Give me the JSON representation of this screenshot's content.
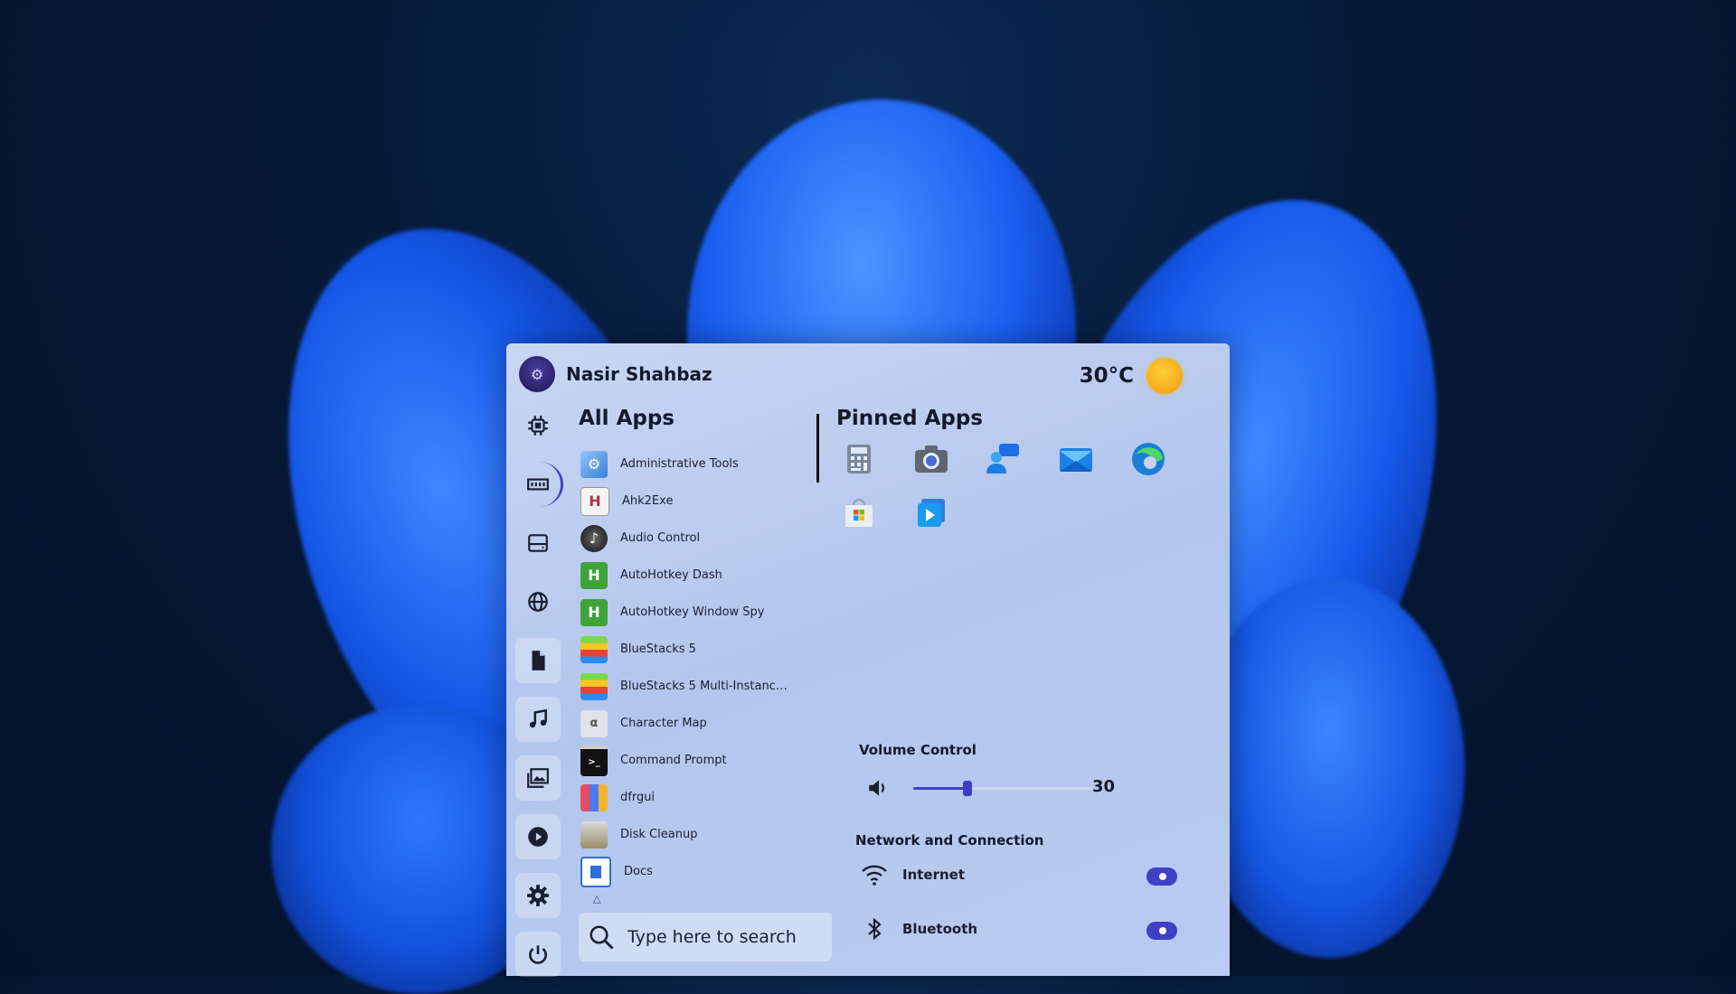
{
  "user": {
    "name": "Nasir Shahbaz"
  },
  "weather": {
    "temperature": "30°C",
    "icon": "sun-icon"
  },
  "sections": {
    "all_apps": "All Apps",
    "pinned_apps": "Pinned Apps"
  },
  "rail": [
    {
      "icon": "cpu-icon"
    },
    {
      "icon": "memory-icon"
    },
    {
      "icon": "drive-icon"
    },
    {
      "icon": "globe-icon"
    },
    {
      "icon": "document-icon"
    },
    {
      "icon": "music-icon"
    },
    {
      "icon": "pictures-icon"
    },
    {
      "icon": "video-play-icon"
    },
    {
      "icon": "settings-gear-icon"
    },
    {
      "icon": "power-icon"
    }
  ],
  "all_apps": [
    {
      "label": "Administrative Tools",
      "icon": "admin-tools-icon"
    },
    {
      "label": "Ahk2Exe",
      "icon": "ahk2exe-icon"
    },
    {
      "label": "Audio Control",
      "icon": "audio-control-icon"
    },
    {
      "label": "AutoHotkey Dash",
      "icon": "autohotkey-icon"
    },
    {
      "label": "AutoHotkey Window Spy",
      "icon": "autohotkey-icon"
    },
    {
      "label": "BlueStacks 5",
      "icon": "bluestacks-icon"
    },
    {
      "label": "BlueStacks 5 Multi-Instance...",
      "icon": "bluestacks-icon"
    },
    {
      "label": "Character Map",
      "icon": "character-map-icon"
    },
    {
      "label": "Command Prompt",
      "icon": "command-prompt-icon"
    },
    {
      "label": "dfrgui",
      "icon": "dfrgui-icon"
    },
    {
      "label": "Disk Cleanup",
      "icon": "disk-cleanup-icon"
    },
    {
      "label": "Docs",
      "icon": "docs-icon"
    }
  ],
  "pinned": [
    {
      "icon": "calculator-icon"
    },
    {
      "icon": "camera-icon"
    },
    {
      "icon": "feedback-chat-icon"
    },
    {
      "icon": "mail-icon"
    },
    {
      "icon": "edge-browser-icon"
    },
    {
      "icon": "store-icon"
    },
    {
      "icon": "media-player-icon"
    }
  ],
  "volume": {
    "title": "Volume Control",
    "value": "30",
    "level": 0.3
  },
  "network": {
    "title": "Network and Connection",
    "items": [
      {
        "label": "Internet",
        "icon": "wifi-icon",
        "enabled": true
      },
      {
        "label": "Bluetooth",
        "icon": "bluetooth-icon",
        "enabled": true
      }
    ]
  },
  "search": {
    "placeholder": "Type here to search"
  },
  "colors": {
    "accent": "#3f40c4",
    "panel": "#b9cbf0",
    "text": "#141a2c"
  }
}
